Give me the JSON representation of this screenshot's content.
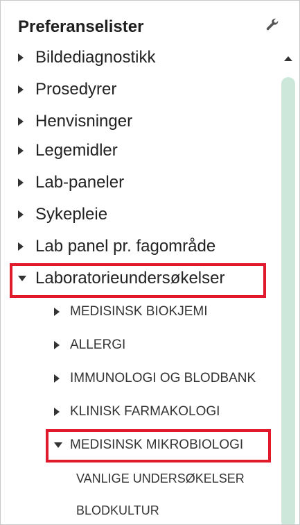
{
  "panel": {
    "title": "Preferanselister",
    "settings_icon": "wrench-icon",
    "highlight_color": "#e0192d",
    "scrollbar_color": "#cde8da"
  },
  "tree": {
    "level0": [
      {
        "label": "Bildediagnostikk",
        "state": "collapsed"
      },
      {
        "label": "Prosedyrer",
        "state": "collapsed"
      },
      {
        "label": "Henvisninger",
        "state": "collapsed"
      },
      {
        "label": "Legemidler",
        "state": "collapsed"
      },
      {
        "label": "Lab-paneler",
        "state": "collapsed"
      },
      {
        "label": "Sykepleie",
        "state": "collapsed"
      },
      {
        "label": "Lab panel pr. fagområde",
        "state": "collapsed"
      },
      {
        "label": "Laboratorieundersøkelser",
        "state": "expanded",
        "highlighted": true
      }
    ],
    "level1": [
      {
        "label": "MEDISINSK BIOKJEMI",
        "state": "collapsed"
      },
      {
        "label": "ALLERGI",
        "state": "collapsed"
      },
      {
        "label": "IMMUNOLOGI OG BLODBANK",
        "state": "collapsed"
      },
      {
        "label": "KLINISK FARMAKOLOGI",
        "state": "collapsed"
      },
      {
        "label": "MEDISINSK MIKROBIOLOGI",
        "state": "expanded",
        "highlighted": true
      }
    ],
    "level2": [
      {
        "label": "VANLIGE UNDERSØKELSER"
      },
      {
        "label": "BLODKULTUR"
      }
    ]
  }
}
